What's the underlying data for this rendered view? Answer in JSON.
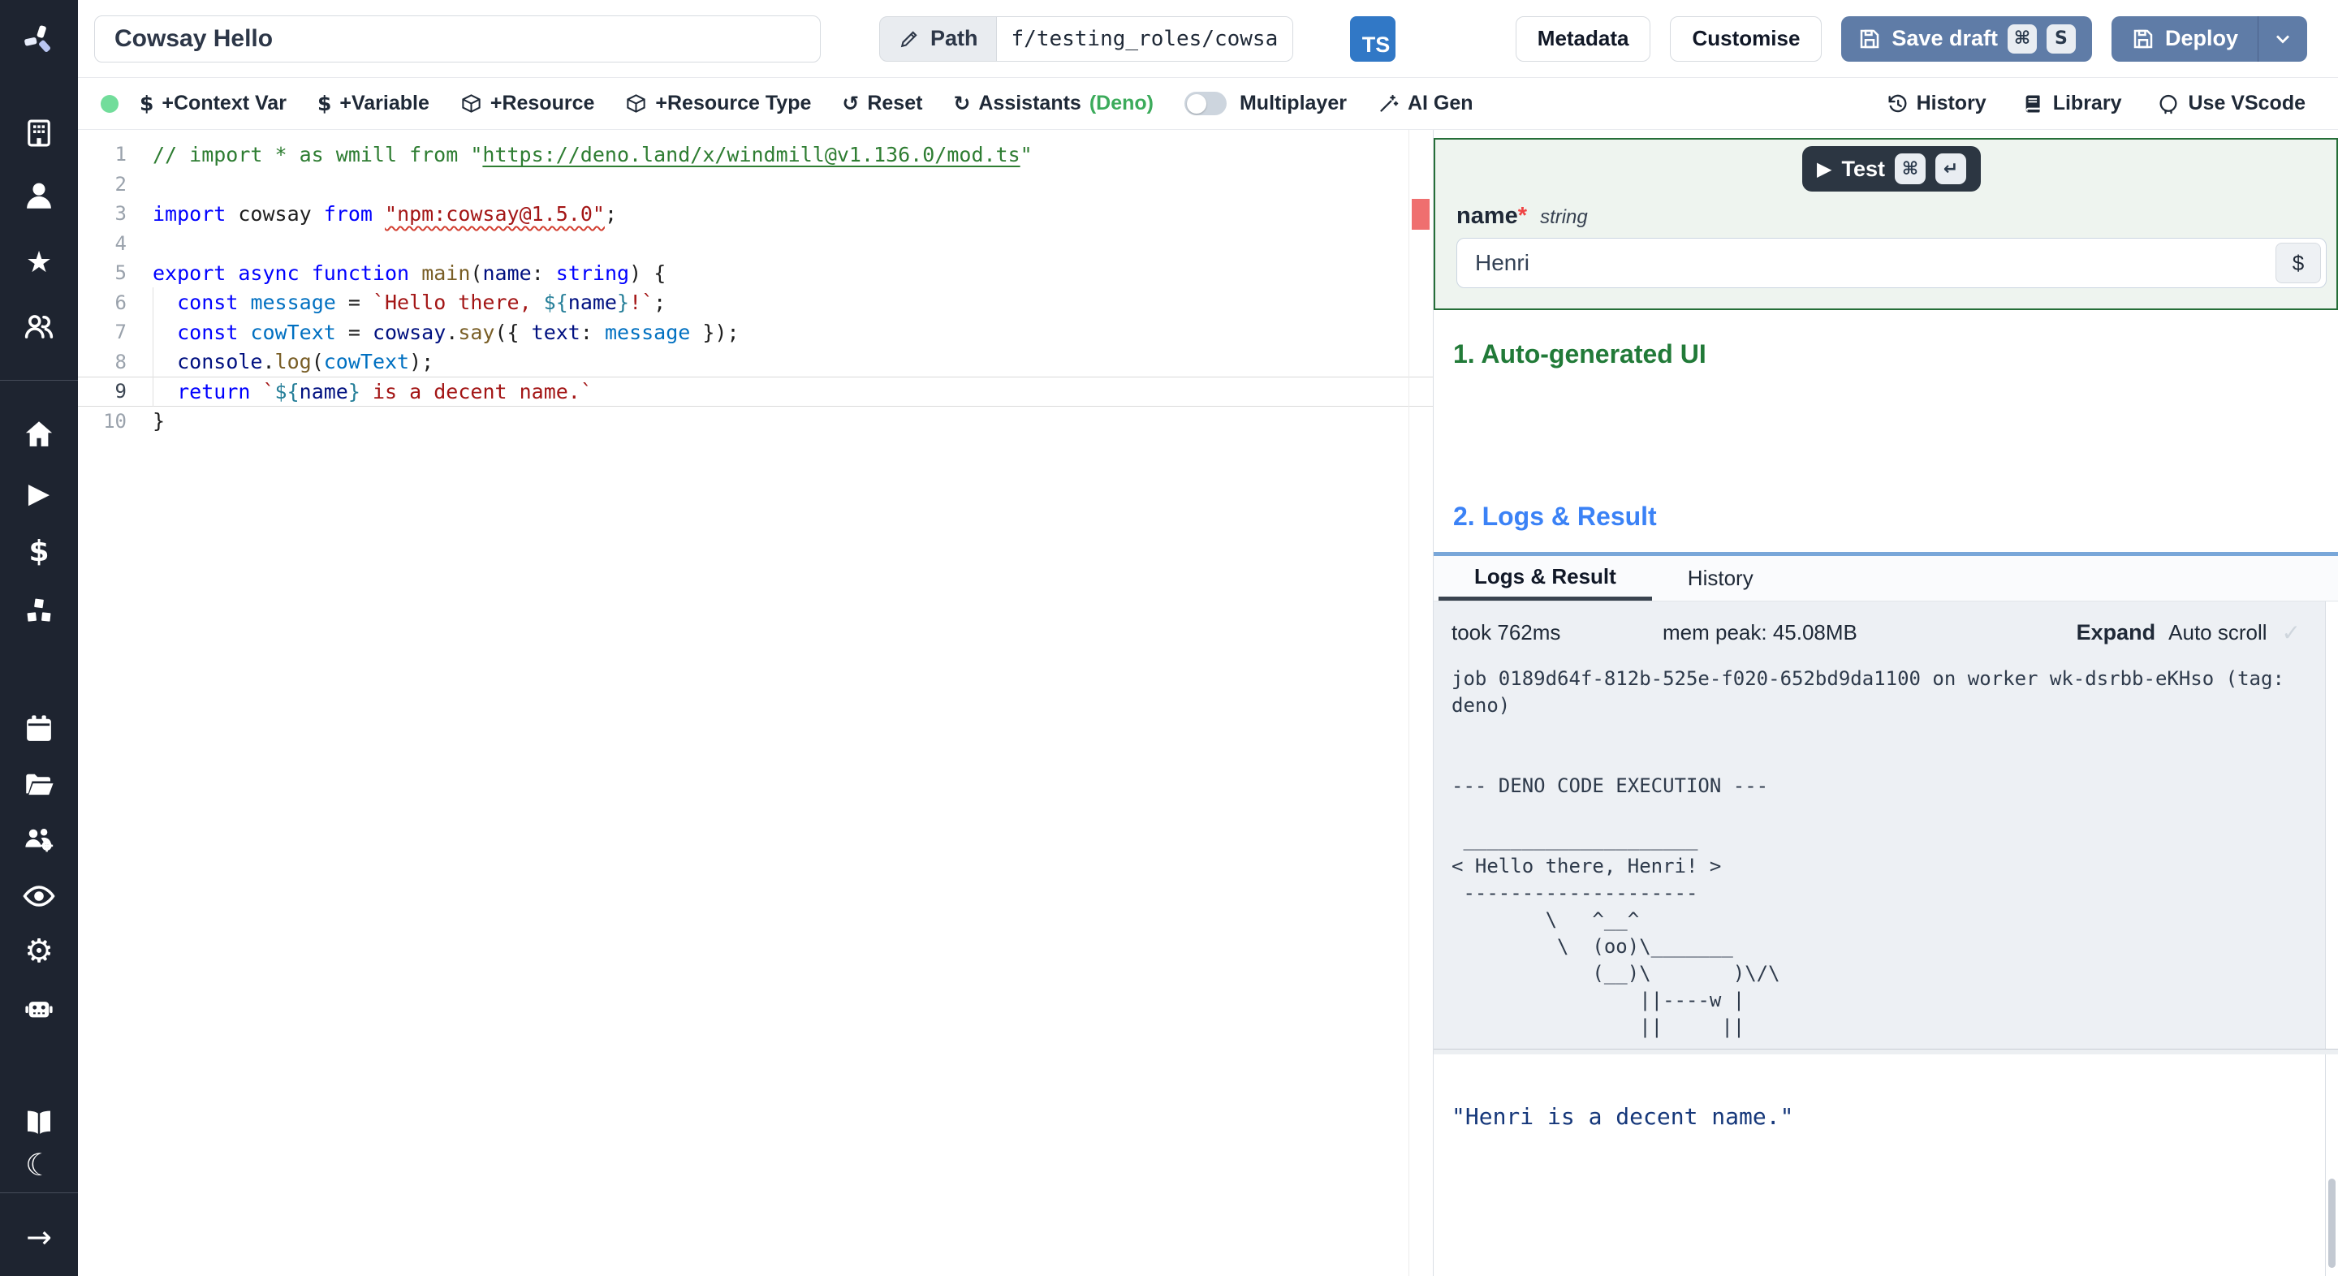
{
  "header": {
    "title_value": "Cowsay Hello",
    "path_label": "Path",
    "path_value": "f/testing_roles/cowsa",
    "lang_badge": "TS",
    "metadata_label": "Metadata",
    "customise_label": "Customise",
    "save_draft_label": "Save draft",
    "save_shortcut_mod": "⌘",
    "save_shortcut_key": "S",
    "deploy_label": "Deploy"
  },
  "toolbar": {
    "dollar_icon": "$",
    "context_var": "+Context Var",
    "variable": "+Variable",
    "resource": "+Resource",
    "resource_type": "+Resource Type",
    "reset_icon": "↺",
    "reset": "Reset",
    "assistants_icon": "↻",
    "assistants": "Assistants",
    "assistants_lang": "(Deno)",
    "multiplayer": "Multiplayer",
    "ai_gen": "AI Gen",
    "history_icon": "↺",
    "history": "History",
    "library": "Library",
    "use_vscode": "Use VScode"
  },
  "editor": {
    "lines": [
      {
        "n": 1,
        "segs": [
          [
            "cm",
            "// import * as wmill from \""
          ],
          [
            "cm lk",
            "https://deno.land/x/windmill@v1.136.0/mod.ts"
          ],
          [
            "cm",
            "\""
          ]
        ]
      },
      {
        "n": 2,
        "segs": []
      },
      {
        "n": 3,
        "segs": [
          [
            "k",
            "import"
          ],
          [
            "d",
            " cowsay "
          ],
          [
            "k",
            "from"
          ],
          [
            "d",
            " "
          ],
          [
            "s err",
            "\"npm:cowsay@1.5.0\""
          ],
          [
            "d",
            ";"
          ]
        ]
      },
      {
        "n": 4,
        "segs": []
      },
      {
        "n": 5,
        "segs": [
          [
            "k",
            "export"
          ],
          [
            "d",
            " "
          ],
          [
            "k",
            "async"
          ],
          [
            "d",
            " "
          ],
          [
            "k",
            "function"
          ],
          [
            "d",
            " "
          ],
          [
            "f",
            "main"
          ],
          [
            "d",
            "("
          ],
          [
            "v",
            "name"
          ],
          [
            "d",
            ": "
          ],
          [
            "k",
            "string"
          ],
          [
            "d",
            ") {"
          ]
        ]
      },
      {
        "n": 6,
        "g": true,
        "segs": [
          [
            "d",
            "  "
          ],
          [
            "k",
            "const"
          ],
          [
            "d",
            " "
          ],
          [
            "v2",
            "message"
          ],
          [
            "d",
            " = "
          ],
          [
            "s",
            "`Hello there, "
          ],
          [
            "tpl",
            "${"
          ],
          [
            "v",
            "name"
          ],
          [
            "tpl",
            "}"
          ],
          [
            "s",
            "!`"
          ],
          [
            "d",
            ";"
          ]
        ]
      },
      {
        "n": 7,
        "g": true,
        "segs": [
          [
            "d",
            "  "
          ],
          [
            "k",
            "const"
          ],
          [
            "d",
            " "
          ],
          [
            "v2",
            "cowText"
          ],
          [
            "d",
            " = "
          ],
          [
            "v",
            "cowsay"
          ],
          [
            "d",
            "."
          ],
          [
            "f",
            "say"
          ],
          [
            "d",
            "({ "
          ],
          [
            "v",
            "text"
          ],
          [
            "d",
            ": "
          ],
          [
            "v2",
            "message"
          ],
          [
            "d",
            " });"
          ]
        ]
      },
      {
        "n": 8,
        "g": true,
        "segs": [
          [
            "d",
            "  "
          ],
          [
            "v",
            "console"
          ],
          [
            "d",
            "."
          ],
          [
            "f",
            "log"
          ],
          [
            "d",
            "("
          ],
          [
            "v2",
            "cowText"
          ],
          [
            "d",
            ");"
          ]
        ]
      },
      {
        "n": 9,
        "g": true,
        "current": true,
        "segs": [
          [
            "d",
            "  "
          ],
          [
            "k",
            "return"
          ],
          [
            "d",
            " "
          ],
          [
            "s",
            "`"
          ],
          [
            "tpl",
            "${"
          ],
          [
            "v",
            "name"
          ],
          [
            "tpl",
            "}"
          ],
          [
            "s",
            " is a decent name.`"
          ]
        ]
      },
      {
        "n": 10,
        "segs": [
          [
            "d",
            "}"
          ]
        ]
      }
    ]
  },
  "right": {
    "test_label": "Test",
    "test_mod": "⌘",
    "test_enter": "↵",
    "arg_name": "name",
    "arg_required": "*",
    "arg_type": "string",
    "arg_value": "Henri",
    "dollar_button": "$",
    "section1": "1. Auto-generated UI",
    "section2": "2. Logs & Result",
    "tabs": [
      "Logs & Result",
      "History"
    ],
    "took": "took 762ms",
    "mem": "mem peak: 45.08MB",
    "expand": "Expand",
    "autoscroll": "Auto scroll",
    "autoscroll_check": "✓",
    "logs_text": "job 0189d64f-812b-525e-f020-652bd9da1100 on worker wk-dsrbb-eKHso (tag:\ndeno)\n\n\n--- DENO CODE EXECUTION ---\n\n ____________________\n< Hello there, Henri! >\n --------------------\n        \\   ^__^\n         \\  (oo)\\_______\n            (__)\\       )\\/\\\n                ||----w |\n                ||     ||",
    "result_text": "\"Henri is a decent name.\""
  },
  "colors": {
    "sidebar_bg": "#1e2430",
    "primary_button": "#5f7ca7",
    "test_button": "#2c3642",
    "ts_badge": "#3178c6",
    "green_accent": "#217a38",
    "deno_green": "#3cab5b",
    "blue_heading": "#3b82f6",
    "blue_splitter": "#79a7d9",
    "error_marker": "#ef6f6f",
    "logs_bg": "#edf0f4",
    "result_text": "#15377a"
  }
}
